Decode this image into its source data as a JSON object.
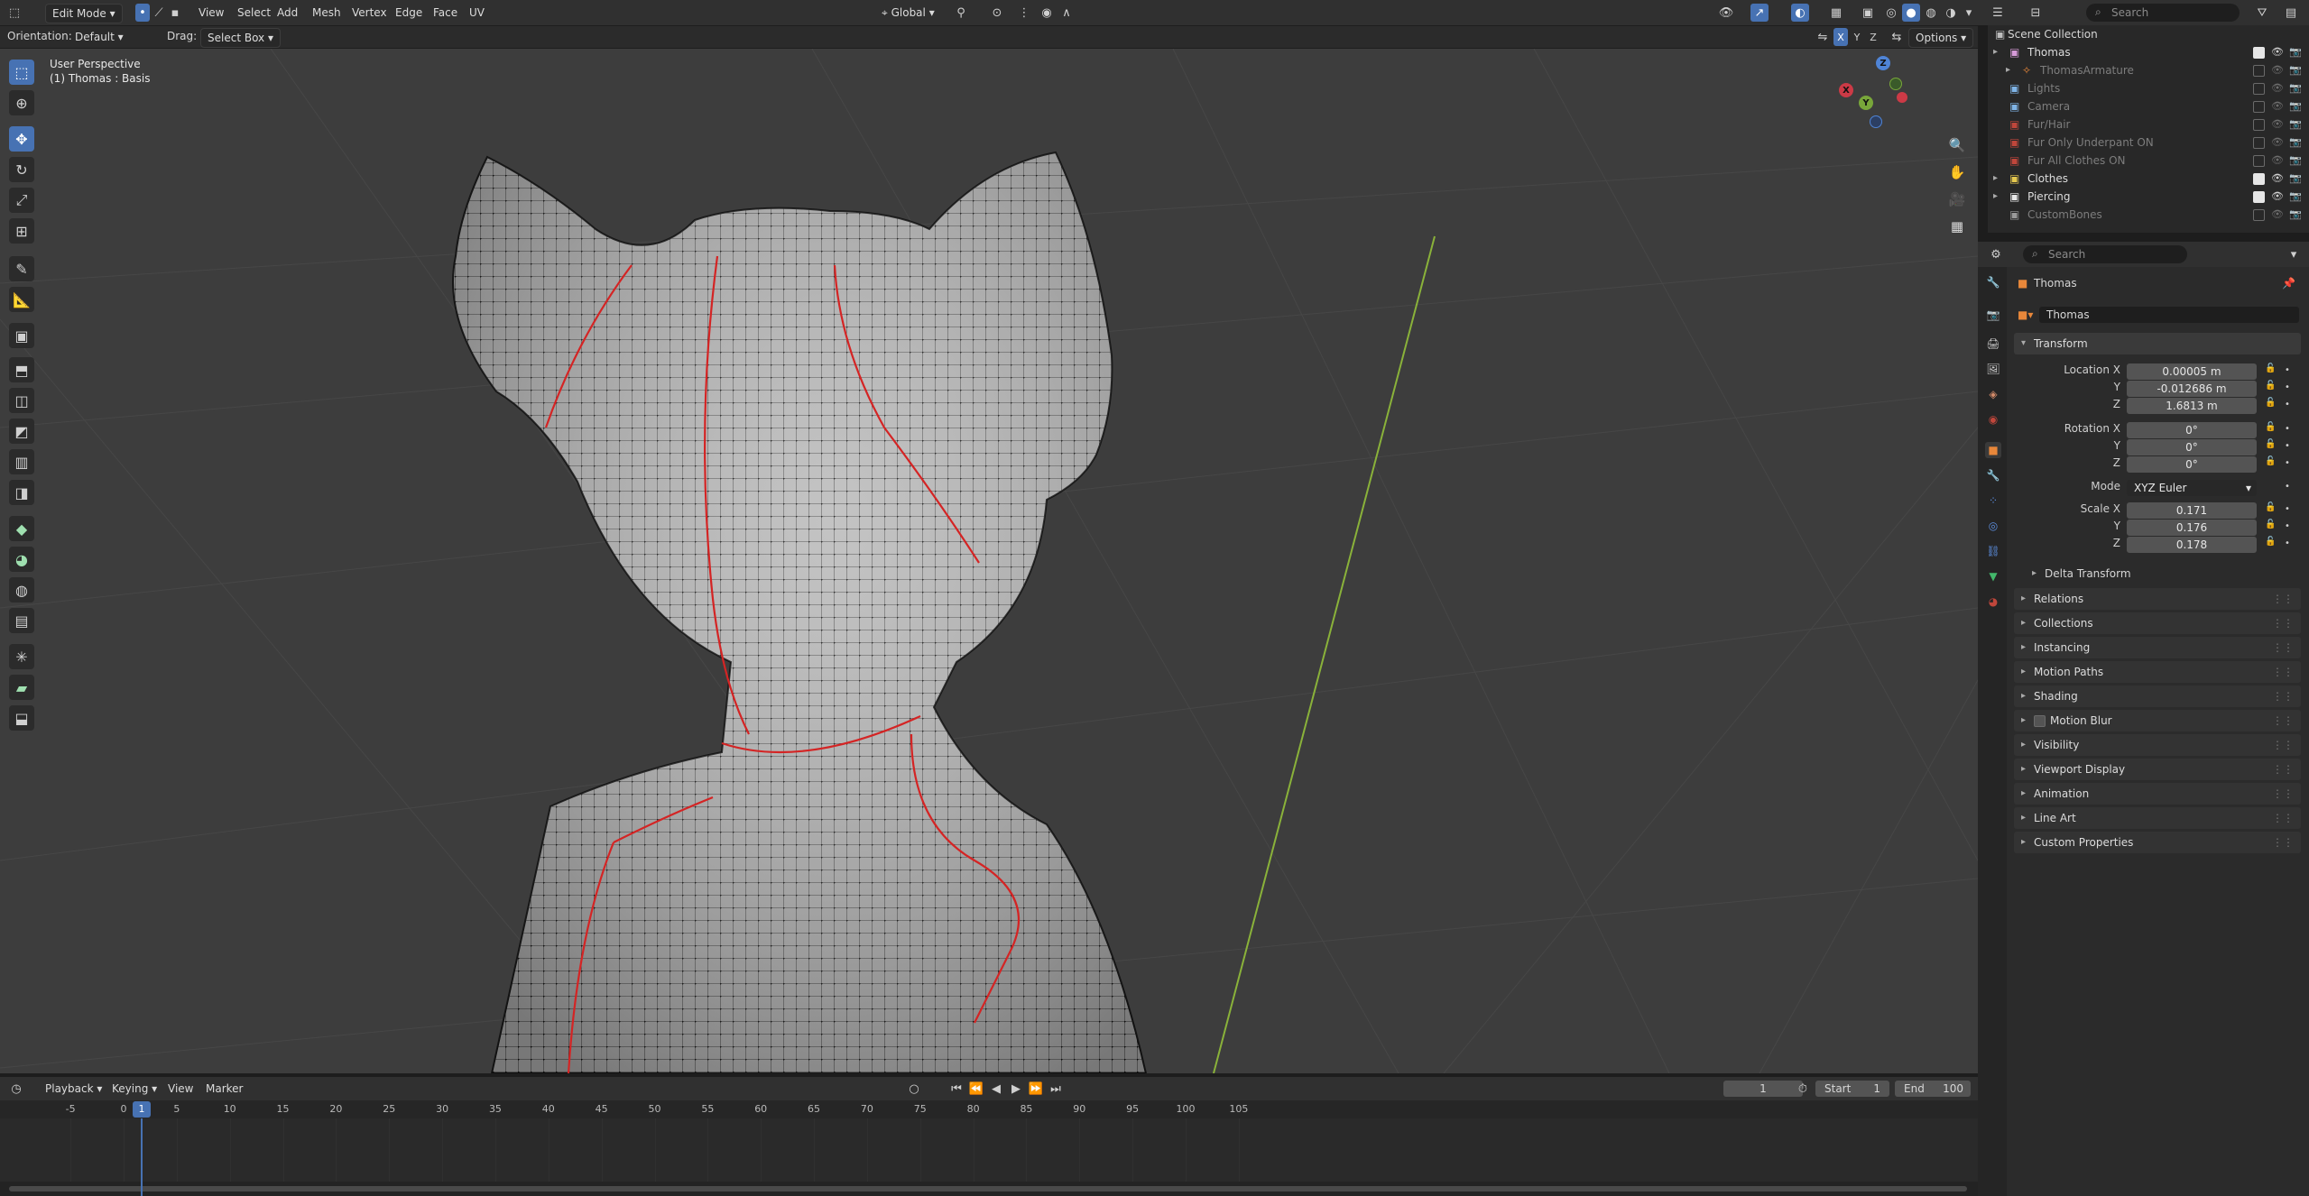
{
  "header": {
    "mode": "Edit Mode",
    "menus": [
      "View",
      "Select",
      "Add",
      "Mesh",
      "Vertex",
      "Edge",
      "Face",
      "UV"
    ],
    "transform_orientation": "Global",
    "options_label": "Options",
    "axes": [
      "X",
      "Y",
      "Z"
    ]
  },
  "tool_settings": {
    "orientation_label": "Orientation:",
    "orientation_value": "Default",
    "drag_label": "Drag:",
    "drag_value": "Select Box"
  },
  "viewport": {
    "perspective": "User Perspective",
    "object_info": "(1) Thomas : Basis",
    "gizmo": {
      "x": "X",
      "y": "Y",
      "z": "Z"
    }
  },
  "timeline": {
    "menus": [
      "Playback",
      "Keying",
      "View",
      "Marker"
    ],
    "current_frame": "1",
    "start_label": "Start",
    "start": "1",
    "end_label": "End",
    "end": "100",
    "ticks": [
      "-5",
      "0",
      "1",
      "5",
      "10",
      "15",
      "20",
      "25",
      "30",
      "35",
      "40",
      "45",
      "50",
      "55",
      "60",
      "65",
      "70",
      "75",
      "80",
      "85",
      "90",
      "95",
      "100",
      "105"
    ]
  },
  "outliner": {
    "search_placeholder": "Search",
    "root": "Scene Collection",
    "items": [
      {
        "name": "Thomas",
        "dim": false
      },
      {
        "name": "ThomasArmature",
        "dim": true
      },
      {
        "name": "Lights",
        "dim": true
      },
      {
        "name": "Camera",
        "dim": true
      },
      {
        "name": "Fur/Hair",
        "dim": true
      },
      {
        "name": "Fur Only Underpant ON",
        "dim": true
      },
      {
        "name": "Fur All Clothes ON",
        "dim": true
      },
      {
        "name": "Clothes",
        "dim": false
      },
      {
        "name": "Piercing",
        "dim": false
      },
      {
        "name": "CustomBones",
        "dim": true
      }
    ]
  },
  "properties": {
    "search_placeholder": "Search",
    "object_title": "Thomas",
    "object_name": "Thomas",
    "transform_label": "Transform",
    "location_label": "Location X",
    "rotation_label": "Rotation X",
    "scale_label": "Scale X",
    "y_label": "Y",
    "z_label": "Z",
    "mode_label": "Mode",
    "location": [
      "0.00005 m",
      "-0.012686 m",
      "1.6813 m"
    ],
    "rotation": [
      "0°",
      "0°",
      "0°"
    ],
    "mode": "XYZ Euler",
    "scale": [
      "0.171",
      "0.176",
      "0.178"
    ],
    "delta_transform": "Delta Transform",
    "panels": [
      "Relations",
      "Collections",
      "Instancing",
      "Motion Paths",
      "Shading",
      "Motion Blur",
      "Visibility",
      "Viewport Display",
      "Animation",
      "Line Art",
      "Custom Properties"
    ]
  },
  "colors": {
    "accent": "#4772b3",
    "seam": "#d42424",
    "mesh": "#b4b4b4",
    "grid_y_axis": "#8ab23a"
  }
}
